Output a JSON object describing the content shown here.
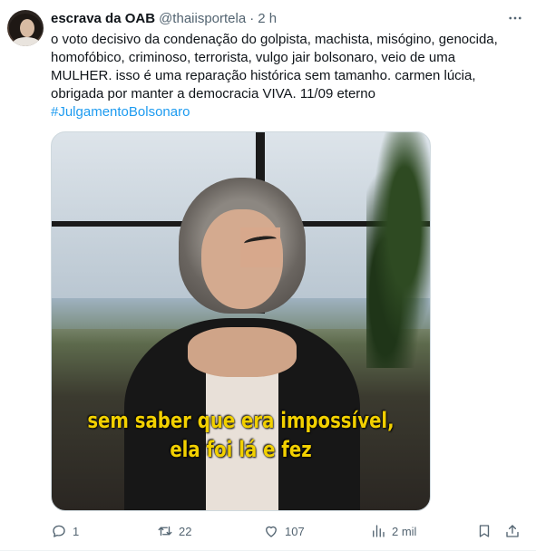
{
  "tweet": {
    "author_name": "escrava da OAB",
    "handle": "@thaiisportela",
    "separator": "·",
    "time": "2 h",
    "text_lines": [
      "o voto decisivo da condenação do golpista, machista, misógino, genocida,",
      "homofóbico, criminoso, terrorista, vulgo jair bolsonaro, veio de uma",
      "MULHER. isso é uma reparação histórica sem tamanho. carmen lúcia,",
      "obrigada por manter a democracia VIVA. 11/09 eterno"
    ],
    "hashtag": "#JulgamentoBolsonaro",
    "media_caption": [
      "sem saber que era impossível,",
      "ela foi lá e fez"
    ]
  },
  "actions": {
    "replies": "1",
    "retweets": "22",
    "likes": "107",
    "views": "2 mil"
  },
  "icons": {
    "more": "more-dots-icon",
    "reply": "reply-bubble-icon",
    "retweet": "retweet-icon",
    "like": "heart-icon",
    "views": "views-bar-chart-icon",
    "bookmark": "bookmark-icon",
    "share": "share-upload-icon"
  },
  "colors": {
    "link": "#1d9bf0",
    "secondary_text": "#536471",
    "caption": "#f2d000"
  }
}
